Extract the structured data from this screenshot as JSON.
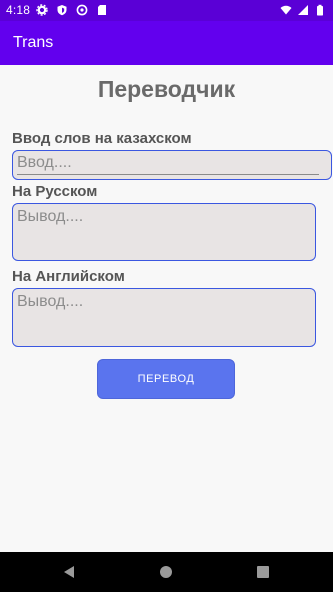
{
  "status_bar": {
    "time": "4:18",
    "left_icons": [
      "gear-icon",
      "shield-icon",
      "sync-icon",
      "sd-card-icon"
    ],
    "right_icons": [
      "wifi-icon",
      "signal-icon",
      "battery-icon"
    ]
  },
  "app_bar": {
    "title": "Trans"
  },
  "main": {
    "page_title": "Переводчик",
    "kazakh": {
      "label": "Ввод слов на казахском",
      "placeholder": "Ввод...."
    },
    "russian": {
      "label": "На Русском",
      "placeholder": "Вывод...."
    },
    "english": {
      "label": "На Английском",
      "placeholder": "Вывод...."
    },
    "translate_button": "ПЕРЕВОД"
  },
  "nav_bar": {
    "buttons": [
      "back-icon",
      "home-icon",
      "recents-icon"
    ]
  },
  "colors": {
    "status_bar": "#5a00d6",
    "app_bar": "#6200ee",
    "button": "#5a74ee",
    "field_border": "#3b57e0"
  }
}
